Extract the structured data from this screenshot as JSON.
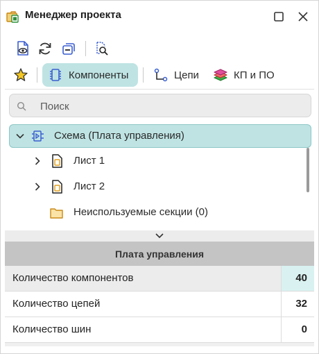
{
  "window": {
    "title": "Менеджер проекта",
    "icons": [
      "project-manager-icon",
      "maximize-icon",
      "close-icon"
    ]
  },
  "toolbar": {
    "icons": [
      "view-document-icon",
      "refresh-icon",
      "collapse-all-icon",
      "find-icon"
    ]
  },
  "tabs": [
    {
      "label": "",
      "icon": "star-icon",
      "active": false
    },
    {
      "label": "Компоненты",
      "icon": "component-icon",
      "active": true
    },
    {
      "label": "Цепи",
      "icon": "net-icon",
      "active": false
    },
    {
      "label": "КП и ПО",
      "icon": "layers-icon",
      "active": false
    }
  ],
  "search": {
    "placeholder": "Поиск",
    "value": ""
  },
  "tree": {
    "root": {
      "label": "Схема (Плата управления)",
      "expanded": true,
      "selected": true
    },
    "children": [
      {
        "label": "Лист 1",
        "expandable": true
      },
      {
        "label": "Лист 2",
        "expandable": true
      },
      {
        "label": "Неиспользуемые секции (0)",
        "expandable": false
      }
    ]
  },
  "properties": {
    "header": "Плата управления",
    "rows": [
      {
        "key": "Количество компонентов",
        "value": "40",
        "highlighted": true
      },
      {
        "key": "Количество цепей",
        "value": "32",
        "highlighted": false
      },
      {
        "key": "Количество шин",
        "value": "0",
        "highlighted": false
      }
    ]
  },
  "colors": {
    "accent": "#bfe3e3",
    "accent_border": "#8cc6c6",
    "header_bg": "#c4c4c4"
  }
}
